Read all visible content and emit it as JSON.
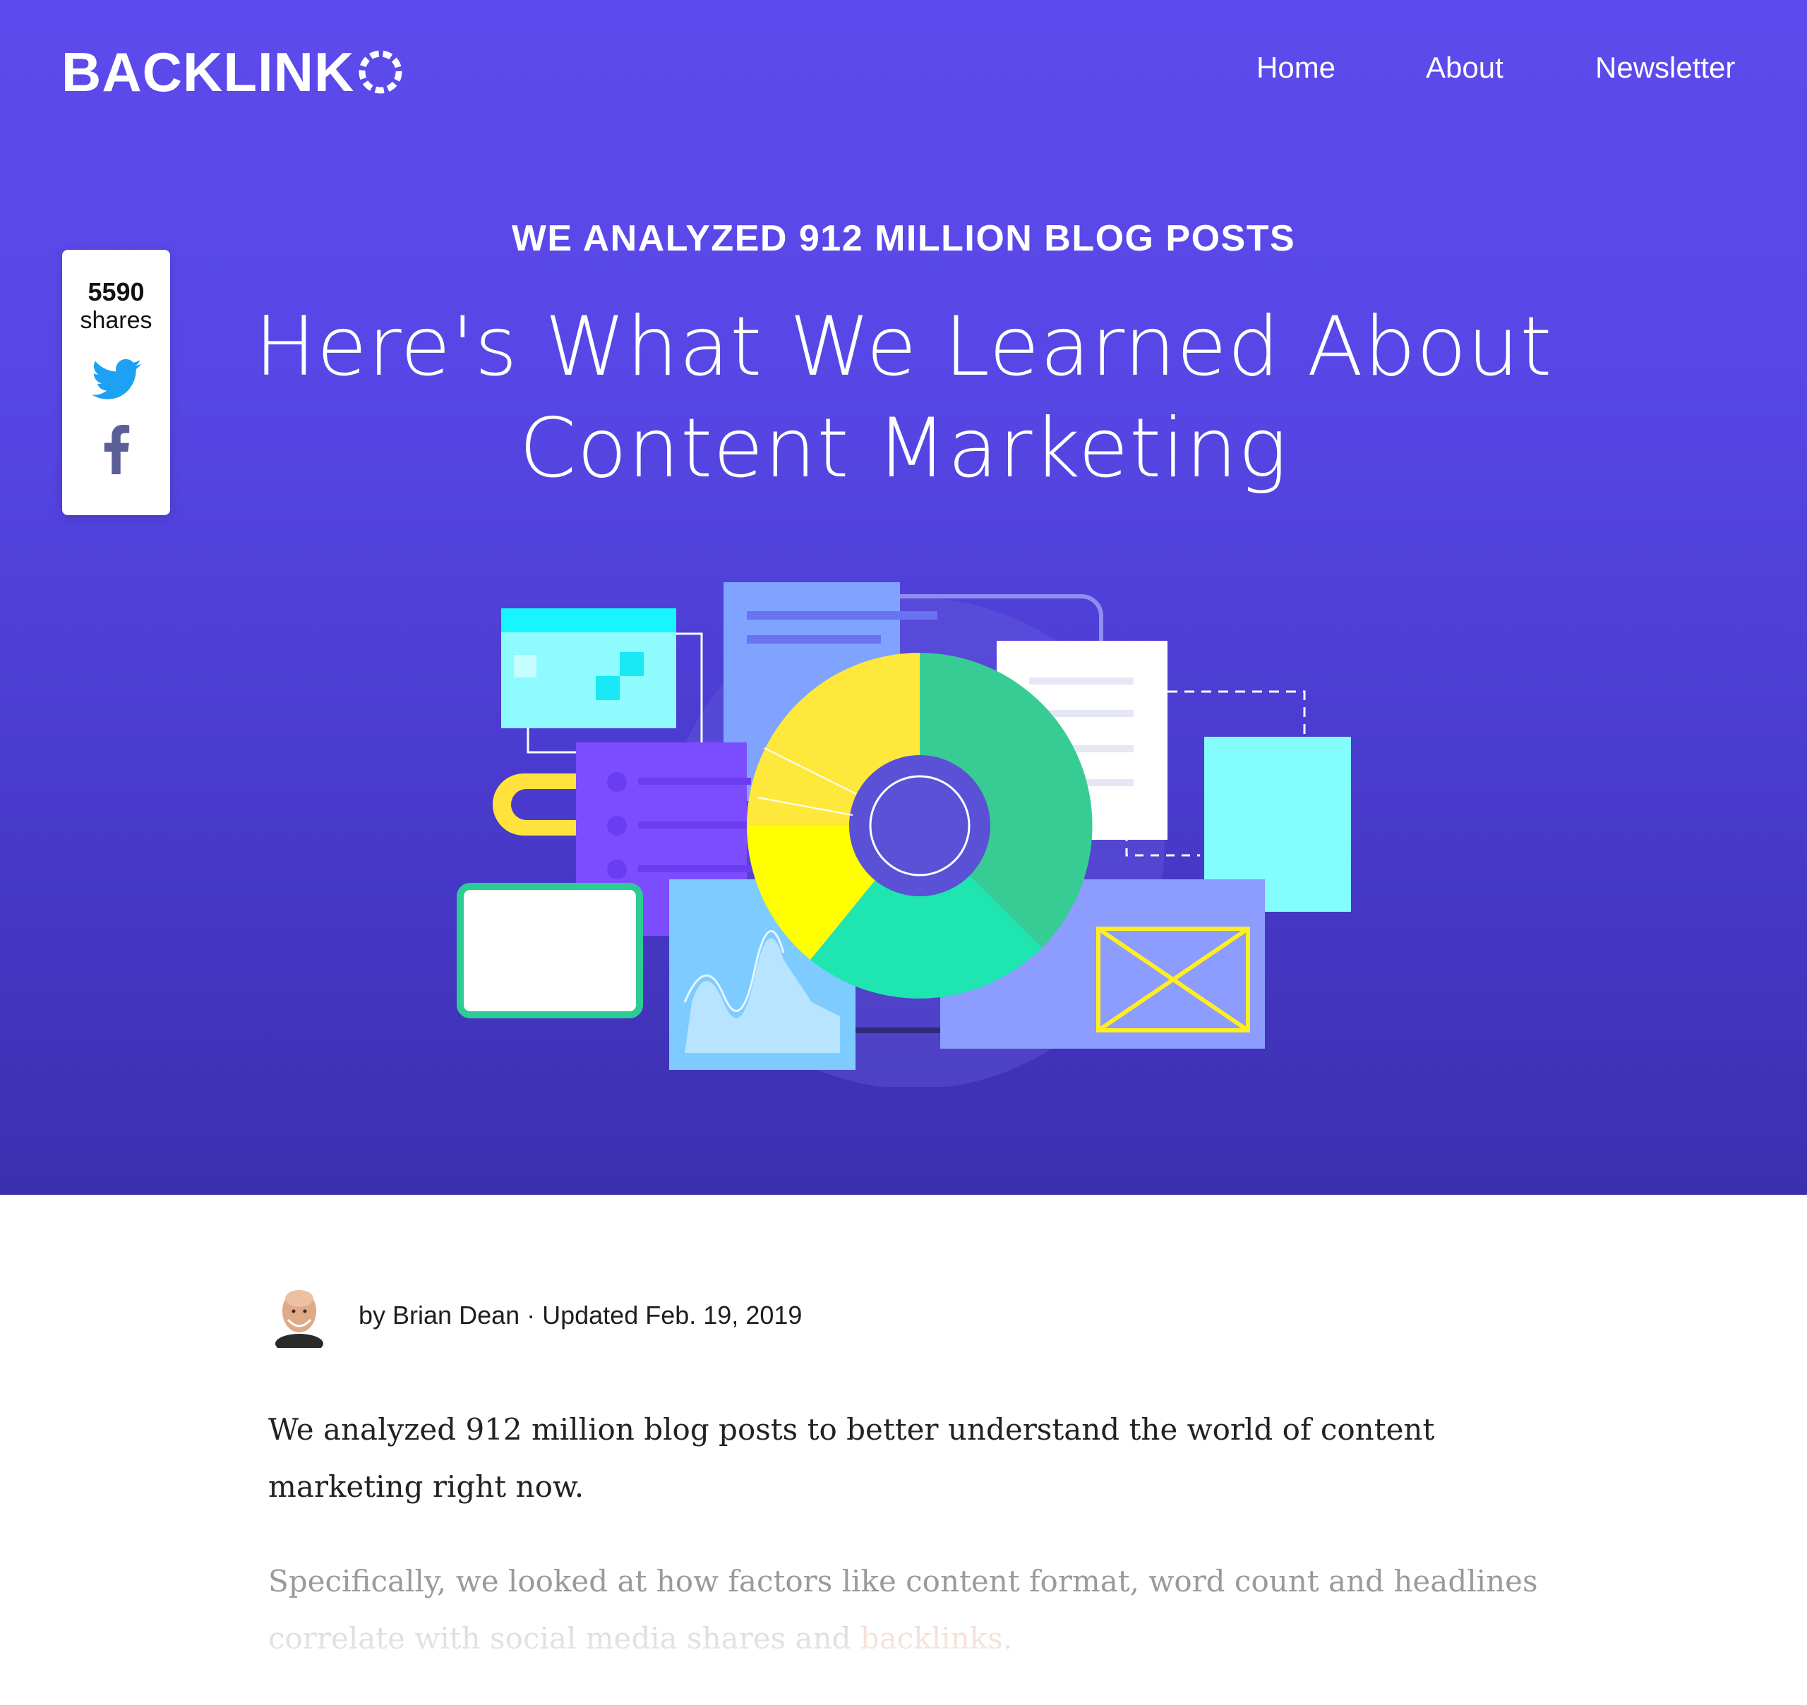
{
  "brand": {
    "logo_text": "BACKLINK"
  },
  "nav": {
    "items": [
      "Home",
      "About",
      "Newsletter"
    ]
  },
  "share": {
    "count": "5590",
    "label": "shares",
    "twitter_color": "#1da1f2",
    "facebook_color": "#5b5f97"
  },
  "hero": {
    "kicker": "WE ANALYZED 912 MILLION BLOG POSTS",
    "title_line1": "Here's What We Learned About",
    "title_line2": "Content Marketing",
    "background": "#5d4aec"
  },
  "byline": {
    "text": "by Brian Dean · Updated Feb. 19, 2019"
  },
  "article": {
    "p1": "We analyzed 912 million blog posts to better understand the world of content marketing right now.",
    "p2_line1": "Specifically, we looked at how factors like content format, word count and headlines",
    "p2_line2_prefix": "correlate with social media shares and ",
    "p2_link": "backlinks",
    "p2_suffix": "."
  }
}
